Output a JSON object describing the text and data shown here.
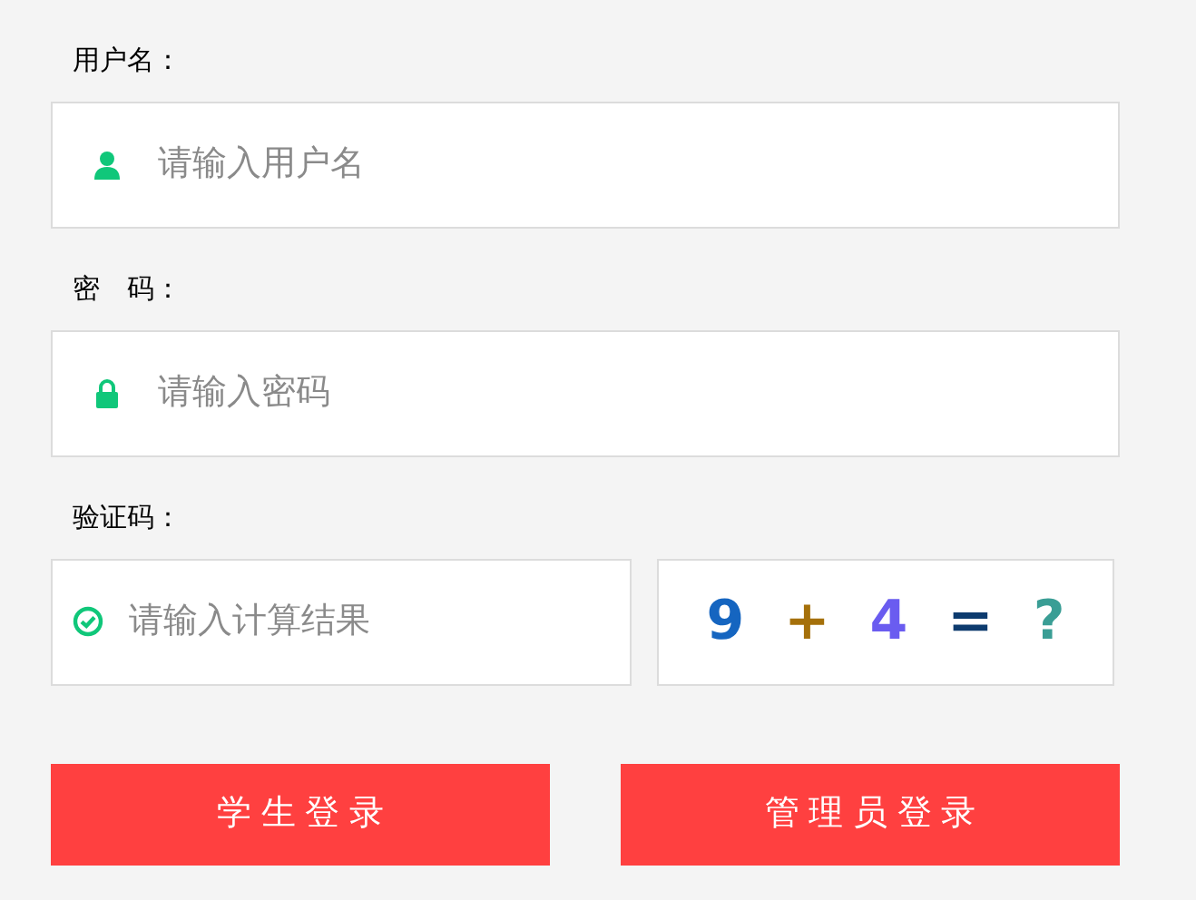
{
  "fields": [
    {
      "kind": "user",
      "label": "用户名：",
      "placeholder": "请输入用户名"
    },
    {
      "kind": "lock",
      "label": "密　码：",
      "placeholder": "请输入密码"
    }
  ],
  "captcha": {
    "label": "验证码：",
    "placeholder": "请输入计算结果",
    "chars": [
      {
        "text": "9",
        "color": "#1565c0"
      },
      {
        "text": "+",
        "color": "#a5700a"
      },
      {
        "text": "4",
        "color": "#6a5cf0"
      },
      {
        "text": "=",
        "color": "#0d3b6e"
      },
      {
        "text": "?",
        "color": "#3a9e95"
      }
    ]
  },
  "buttons": [
    "学 生 登 录",
    "管 理 员 登 录"
  ]
}
